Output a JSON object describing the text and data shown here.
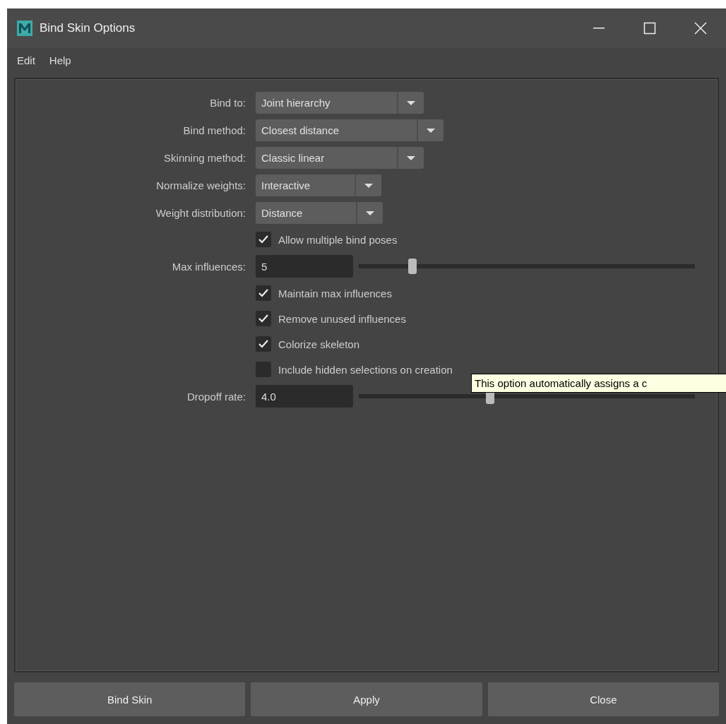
{
  "window": {
    "title": "Bind Skin Options"
  },
  "menu": [
    "Edit",
    "Help"
  ],
  "rows": [
    {
      "kind": "dropdown",
      "label": "Bind to:",
      "value": "Joint hierarchy"
    },
    {
      "kind": "dropdown",
      "label": "Bind method:",
      "value": "Closest distance"
    },
    {
      "kind": "dropdown",
      "label": "Skinning method:",
      "value": "Classic linear"
    },
    {
      "kind": "dropdown",
      "label": "Normalize weights:",
      "value": "Interactive"
    },
    {
      "kind": "dropdown",
      "label": "Weight distribution:",
      "value": "Distance"
    },
    {
      "kind": "checkbox",
      "label": "Allow multiple bind poses",
      "checked": true
    },
    {
      "kind": "slider",
      "label": "Max influences:",
      "value": "5",
      "level": 0.16
    },
    {
      "kind": "checkbox",
      "label": "Maintain max influences",
      "checked": true
    },
    {
      "kind": "checkbox",
      "label": "Remove unused influences",
      "checked": true
    },
    {
      "kind": "checkbox",
      "label": "Colorize skeleton",
      "checked": true
    },
    {
      "kind": "checkbox",
      "label": "Include hidden selections on creation",
      "checked": false
    },
    {
      "kind": "slider",
      "label": "Dropoff rate:",
      "value": "4.0",
      "level": 0.39
    }
  ],
  "tooltip": "This option automatically assigns a c",
  "buttons": [
    "Bind Skin",
    "Apply",
    "Close"
  ]
}
